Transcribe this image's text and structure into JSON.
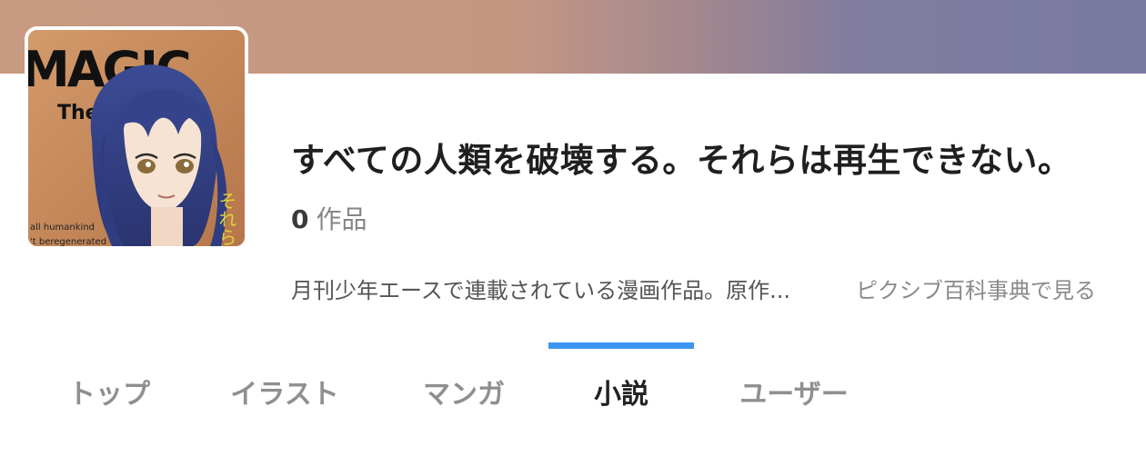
{
  "header": {
    "cover_text": {
      "magic": "MAGIC",
      "sub": "The C",
      "tagline_1": "all humankind",
      "tagline_2": "'t beregenerated",
      "vertical": "それら"
    }
  },
  "tag": {
    "title": "すべての人類を破壊する。それらは再生できない。",
    "work_count": "0",
    "work_count_label": "作品",
    "description": "月刊少年エースで連載されている漫画作品。原作...",
    "encyclopedia_link": "ピクシブ百科事典で見る"
  },
  "tabs": [
    {
      "label": "トップ",
      "active": false
    },
    {
      "label": "イラスト",
      "active": false
    },
    {
      "label": "マンガ",
      "active": false
    },
    {
      "label": "小説",
      "active": true
    },
    {
      "label": "ユーザー",
      "active": false
    }
  ],
  "colors": {
    "accent": "#3d95f2",
    "banner_left": "#c79a81",
    "banner_right": "#7a7aa0"
  }
}
